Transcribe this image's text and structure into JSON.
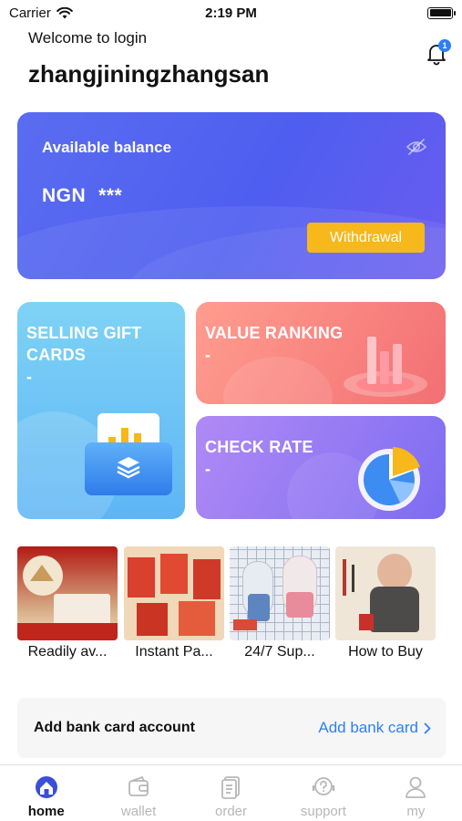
{
  "status": {
    "carrier": "Carrier",
    "time": "2:19 PM"
  },
  "header": {
    "welcome": "Welcome to login",
    "username": "zhangjiningzhangsan",
    "notification_count": "1"
  },
  "balance": {
    "title": "Available balance",
    "currency": "NGN",
    "masked_amount": "***",
    "withdraw_label": "Withdrawal"
  },
  "tiles": {
    "gift": {
      "title_line1": "SELLING GIFT",
      "title_line2": "CARDS",
      "sub": "-"
    },
    "rank": {
      "title": "VALUE RANKING",
      "sub": "-"
    },
    "rate": {
      "title": "CHECK RATE",
      "sub": "-"
    }
  },
  "features": [
    {
      "label": "Readily av..."
    },
    {
      "label": "Instant Pa..."
    },
    {
      "label": "24/7 Sup..."
    },
    {
      "label": "How to Buy"
    }
  ],
  "bank": {
    "label": "Add bank card account",
    "link": "Add bank card"
  },
  "tabs": [
    {
      "label": "home",
      "icon": "home-icon"
    },
    {
      "label": "wallet",
      "icon": "wallet-icon"
    },
    {
      "label": "order",
      "icon": "order-icon"
    },
    {
      "label": "support",
      "icon": "support-icon"
    },
    {
      "label": "my",
      "icon": "person-icon"
    }
  ],
  "colors": {
    "accent": "#2d7ff9",
    "balance_card": "#5563f0",
    "withdraw": "#f6b81a",
    "gift_tile": "#6cc4f5",
    "rank_tile": "#f67d7c",
    "rate_tile": "#9a7bf3"
  }
}
